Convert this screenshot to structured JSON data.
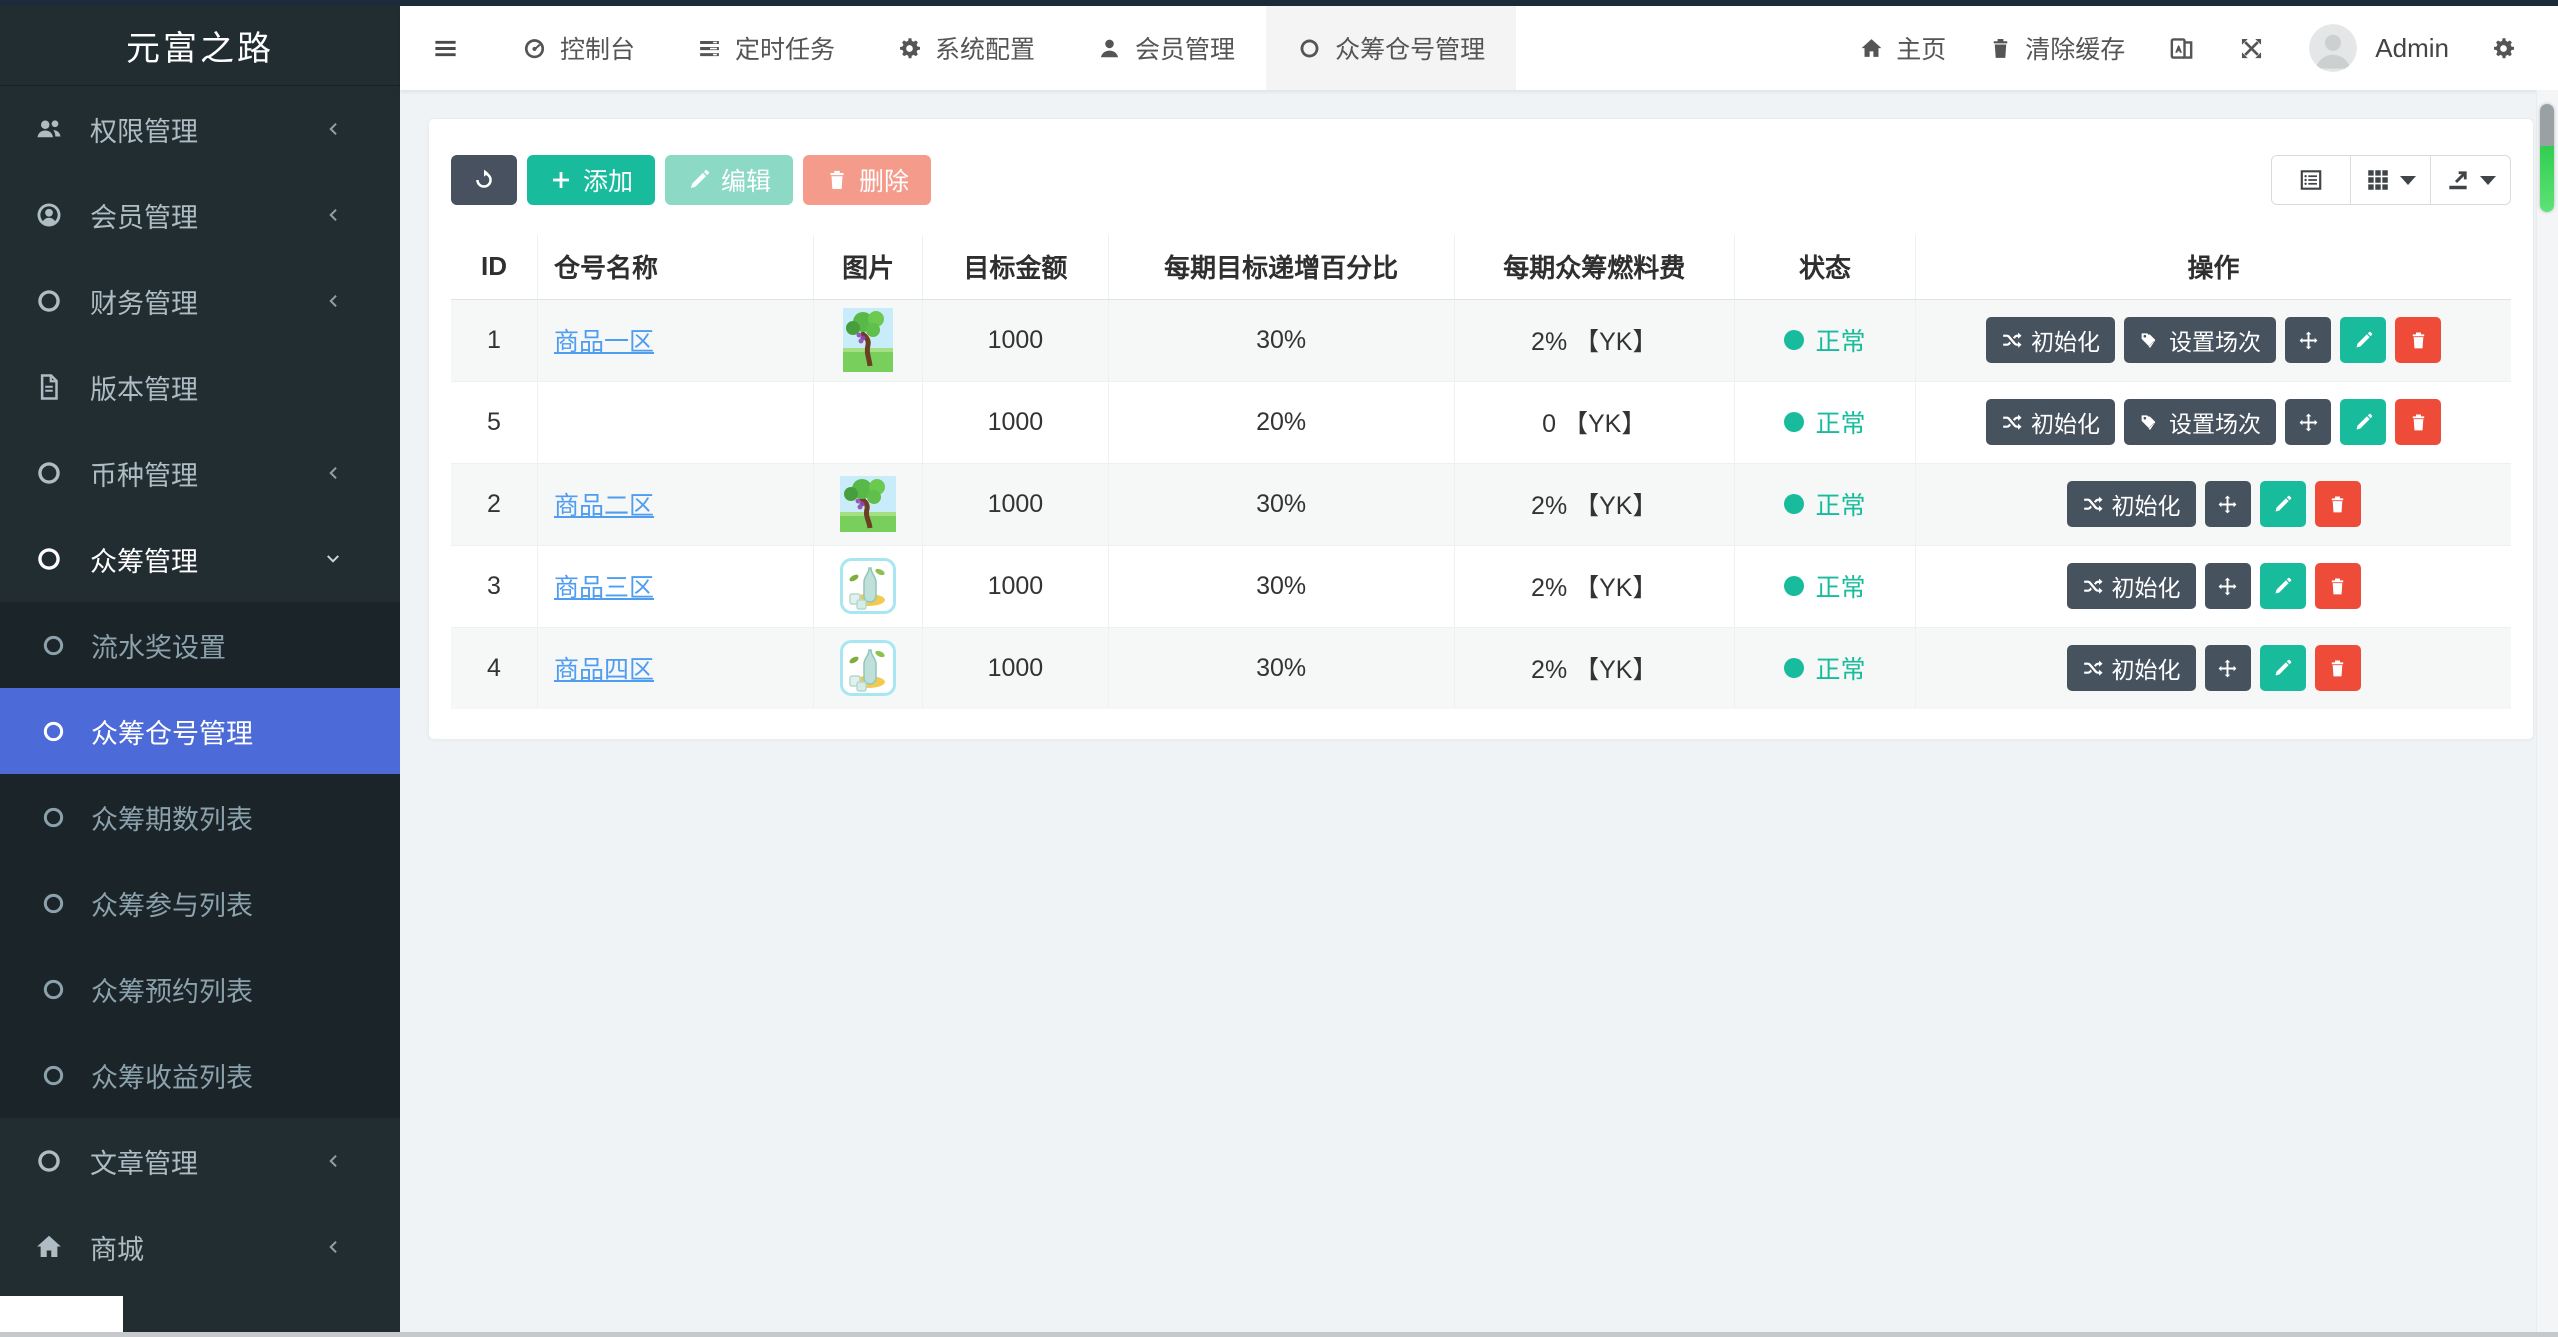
{
  "app": {
    "brand": "元富之路"
  },
  "topnav": {
    "tabs": [
      {
        "label": "控制台",
        "icon": "gauge-icon",
        "active": false
      },
      {
        "label": "定时任务",
        "icon": "tasks-icon",
        "active": false
      },
      {
        "label": "系统配置",
        "icon": "gear-icon",
        "active": false
      },
      {
        "label": "会员管理",
        "icon": "user-icon",
        "active": false
      },
      {
        "label": "众筹仓号管理",
        "icon": "circle-icon",
        "active": true
      }
    ],
    "home_label": "主页",
    "clear_cache_label": "清除缓存",
    "icons_right": [
      "translate-icon",
      "fullscreen-icon"
    ],
    "admin_name": "Admin"
  },
  "sidebar": {
    "items": [
      {
        "label": "权限管理",
        "icon": "users-icon",
        "chevron": "left"
      },
      {
        "label": "会员管理",
        "icon": "user-circle-icon",
        "chevron": "left"
      },
      {
        "label": "财务管理",
        "icon": "circle-icon",
        "chevron": "left"
      },
      {
        "label": "版本管理",
        "icon": "file-icon",
        "chevron": "none"
      },
      {
        "label": "币种管理",
        "icon": "circle-icon",
        "chevron": "left"
      },
      {
        "label": "众筹管理",
        "icon": "circle-icon",
        "chevron": "down",
        "expanded": true
      }
    ],
    "submenu": [
      {
        "label": "流水奖设置",
        "active": false
      },
      {
        "label": "众筹仓号管理",
        "active": true
      },
      {
        "label": "众筹期数列表",
        "active": false
      },
      {
        "label": "众筹参与列表",
        "active": false
      },
      {
        "label": "众筹预约列表",
        "active": false
      },
      {
        "label": "众筹收益列表",
        "active": false
      }
    ],
    "items_bottom": [
      {
        "label": "文章管理",
        "icon": "circle-icon",
        "chevron": "left"
      },
      {
        "label": "商城",
        "icon": "home-icon",
        "chevron": "left"
      }
    ]
  },
  "toolbar": {
    "add_label": "添加",
    "edit_label": "编辑",
    "delete_label": "删除"
  },
  "table": {
    "columns": [
      "ID",
      "仓号名称",
      "图片",
      "目标金额",
      "每期目标递增百分比",
      "每期众筹燃料费",
      "状态",
      "操作"
    ],
    "actions": {
      "init": "初始化",
      "sessions": "设置场次"
    },
    "rows": [
      {
        "id": "1",
        "name": "商品一区",
        "image": "tree",
        "amount": "1000",
        "percent": "30%",
        "fuel": "2% 【YK】",
        "status": "正常",
        "has_sessions": true
      },
      {
        "id": "5",
        "name": "",
        "image": "none",
        "amount": "1000",
        "percent": "20%",
        "fuel": "0 【YK】",
        "status": "正常",
        "has_sessions": true
      },
      {
        "id": "2",
        "name": "商品二区",
        "image": "tree",
        "amount": "1000",
        "percent": "30%",
        "fuel": "2% 【YK】",
        "status": "正常",
        "has_sessions": false
      },
      {
        "id": "3",
        "name": "商品三区",
        "image": "bottle",
        "amount": "1000",
        "percent": "30%",
        "fuel": "2% 【YK】",
        "status": "正常",
        "has_sessions": false
      },
      {
        "id": "4",
        "name": "商品四区",
        "image": "bottle",
        "amount": "1000",
        "percent": "30%",
        "fuel": "2% 【YK】",
        "status": "正常",
        "has_sessions": false
      }
    ]
  },
  "colors": {
    "sidebar_bg": "#222d32",
    "submenu_bg": "#1b2428",
    "active_item_blue": "#4d6bd8",
    "accent_green": "#18bc9c",
    "danger_red": "#ee4b39",
    "dark_button": "#47525f",
    "link_blue": "#4f9df0",
    "stripe_gray": "#f6f7f7",
    "scroll_green": "#3fd35b"
  }
}
